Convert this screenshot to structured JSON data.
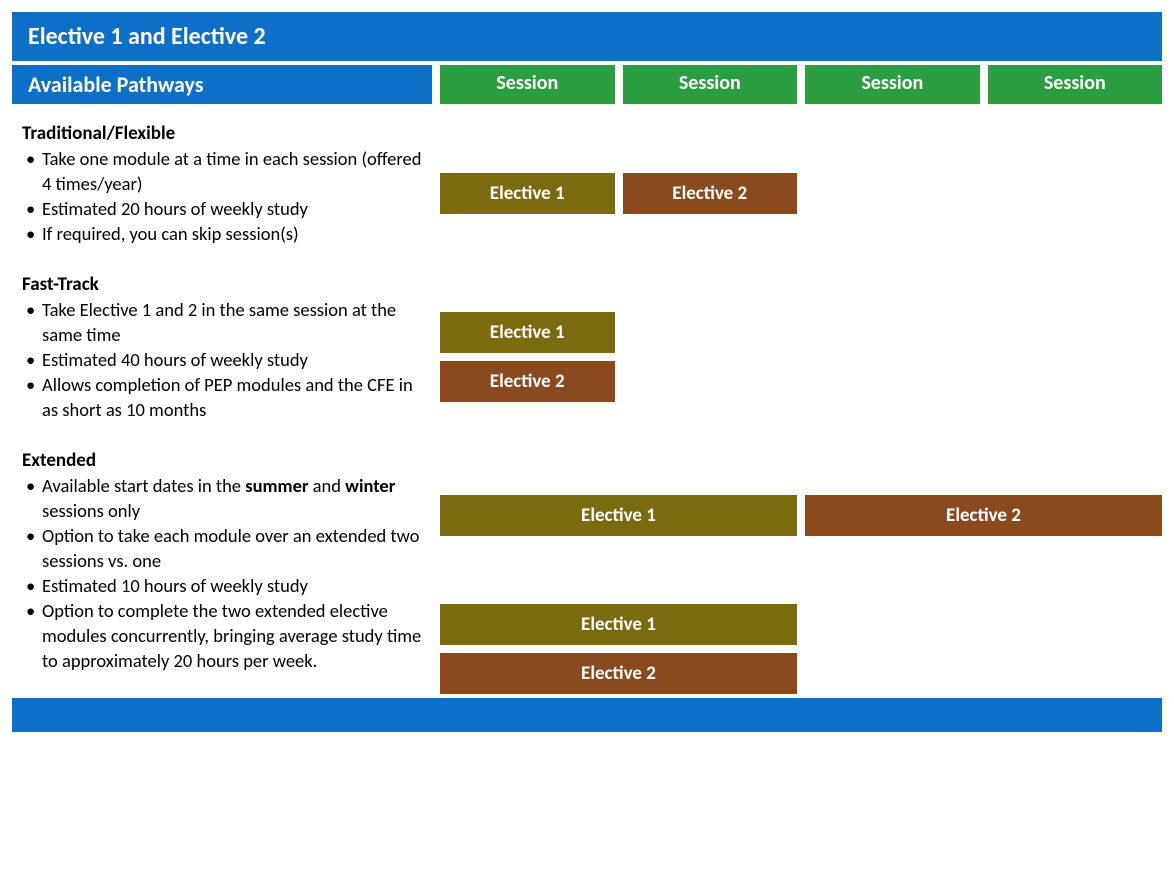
{
  "title": "Elective 1 and Elective 2",
  "pathways_header": "Available Pathways",
  "session_labels": [
    "Session",
    "Session",
    "Session",
    "Session"
  ],
  "modules": {
    "e1": "Elective 1",
    "e2": "Elective 2"
  },
  "sections": {
    "traditional": {
      "title": "Traditional/Flexible",
      "bullets": [
        "Take one module at a time in each session (offered 4 times/year)",
        "Estimated 20 hours of weekly study",
        "If required, you can skip session(s)"
      ]
    },
    "fasttrack": {
      "title": "Fast-Track",
      "bullets": [
        "Take Elective 1 and 2 in the same session at the same time",
        "Estimated 40 hours of weekly study",
        "Allows completion of PEP modules and the CFE in as short as 10 months"
      ]
    },
    "extended": {
      "title": "Extended",
      "bullet0_pre": "Available start dates in the ",
      "bullet0_b1": "summer",
      "bullet0_mid": " and ",
      "bullet0_b2": "winter",
      "bullet0_post": " sessions only",
      "bullets_rest": [
        "Option to take each module over an extended two sessions vs. one",
        "Estimated 10 hours of weekly study",
        "Option to complete the two extended elective modules concurrently, bringing average study time to approximately 20 hours per week."
      ]
    }
  }
}
